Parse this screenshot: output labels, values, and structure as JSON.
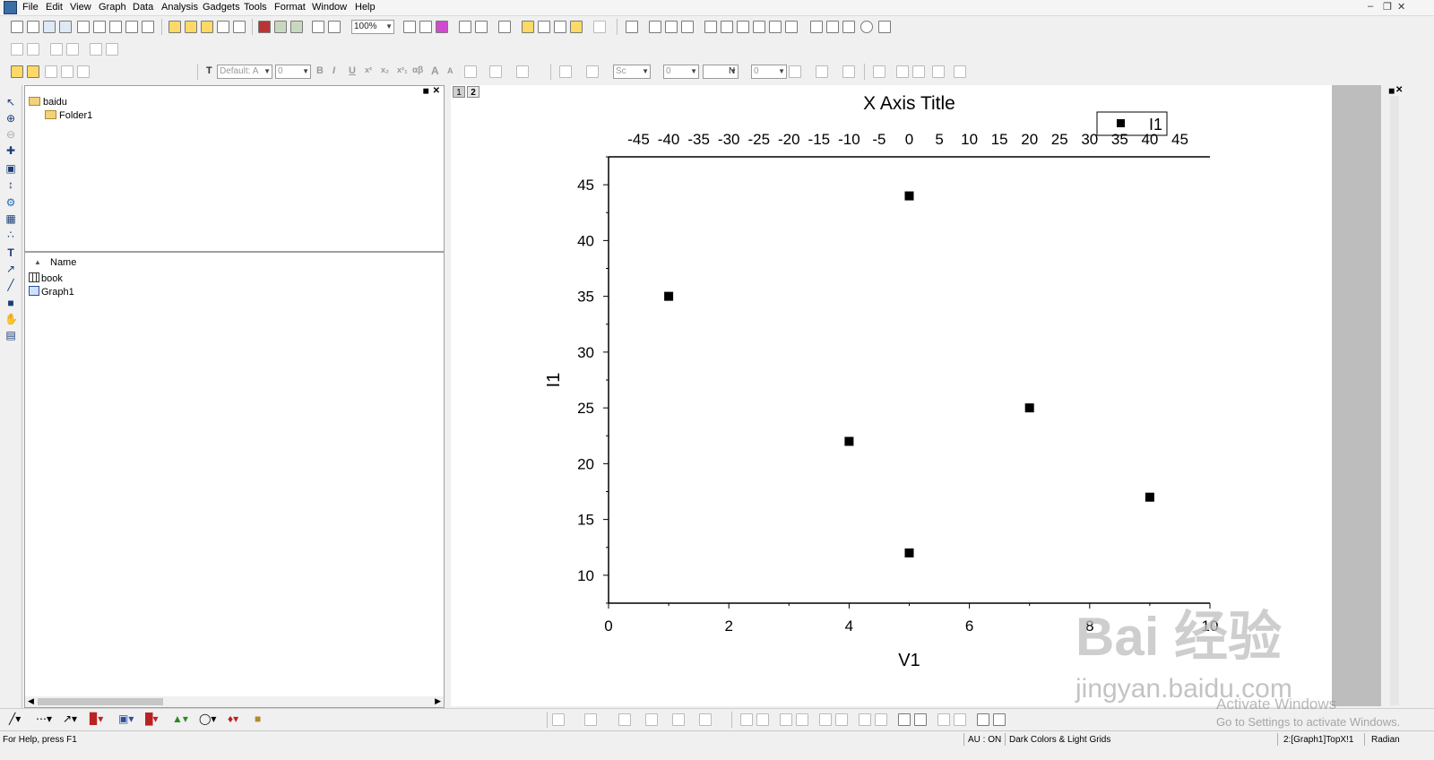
{
  "menu": [
    "File",
    "Edit",
    "View",
    "Graph",
    "Data",
    "Analysis",
    "Gadgets",
    "Tools",
    "Format",
    "Window",
    "Help"
  ],
  "toolbar": {
    "zoom": "100%",
    "font_name": "Default: A",
    "font_size": "0",
    "line_style": "Sc",
    "line_width": "0",
    "fill_label": "N",
    "fill_value": "0",
    "format_glyphs": [
      "B",
      "I",
      "U",
      "x²",
      "x₂",
      "x²₁",
      "αβ",
      "A",
      "A"
    ]
  },
  "project_explorer": {
    "root_folder": "baidu",
    "subfolder": "Folder1",
    "column_name": "Name",
    "items": [
      {
        "icon": "workbook-icon",
        "label": "book"
      },
      {
        "icon": "graph-icon",
        "label": "Graph1"
      }
    ]
  },
  "graph": {
    "layer_tabs": [
      "1",
      "2"
    ],
    "legend_label": "I1"
  },
  "chart_data": {
    "type": "scatter",
    "title": "X Axis Title",
    "xlabel": "V1",
    "ylabel": "I1",
    "xlim": [
      0,
      10
    ],
    "ylim": [
      7.5,
      47.5
    ],
    "x_ticks": [
      0,
      2,
      4,
      6,
      8,
      10
    ],
    "y_ticks": [
      10,
      15,
      20,
      25,
      30,
      35,
      40,
      45
    ],
    "top_axis": {
      "lim": [
        -50,
        50
      ],
      "ticks": [
        -45,
        -40,
        -35,
        -30,
        -25,
        -20,
        -15,
        -10,
        -5,
        0,
        5,
        10,
        15,
        20,
        25,
        30,
        35,
        40,
        45
      ]
    },
    "series": [
      {
        "name": "I1",
        "marker": "square",
        "color": "#000000",
        "points": [
          [
            1,
            35
          ],
          [
            4,
            22
          ],
          [
            5,
            44
          ],
          [
            5,
            12
          ],
          [
            7,
            25
          ],
          [
            9,
            17
          ]
        ]
      }
    ],
    "legend": "top-right",
    "grid": false
  },
  "status": {
    "help": "For Help, press F1",
    "au": "AU : ON",
    "theme": "Dark Colors & Light Grids",
    "active": "2:[Graph1]TopX!1",
    "angle": "Radian"
  },
  "watermark": {
    "activate_title": "Activate Windows",
    "activate_sub": "Go to Settings to activate Windows.",
    "baidu_logo": "Bai 经验",
    "baidu_url": "jingyan.baidu.com"
  },
  "colors": {
    "graph_bg": "#ffffff",
    "chrome": "#f0f0f0",
    "gray_margin": "#bdbdbd",
    "marker": "#000000"
  }
}
